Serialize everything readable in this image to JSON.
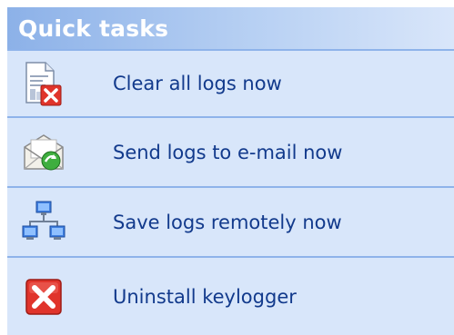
{
  "panel": {
    "title": "Quick tasks"
  },
  "tasks": [
    {
      "label": "Clear all logs now",
      "icon": "clear-logs-icon"
    },
    {
      "label": "Send logs to e-mail now",
      "icon": "email-icon"
    },
    {
      "label": "Save logs remotely now",
      "icon": "network-icon"
    },
    {
      "label": "Uninstall keylogger",
      "icon": "uninstall-icon"
    }
  ],
  "colors": {
    "panel_bg": "#d6e4f8",
    "header_start": "#8cb1e8",
    "header_end": "#d9e6fa",
    "separator": "#8eb3ea",
    "link_text": "#123a8c",
    "danger_red": "#e0342b"
  }
}
